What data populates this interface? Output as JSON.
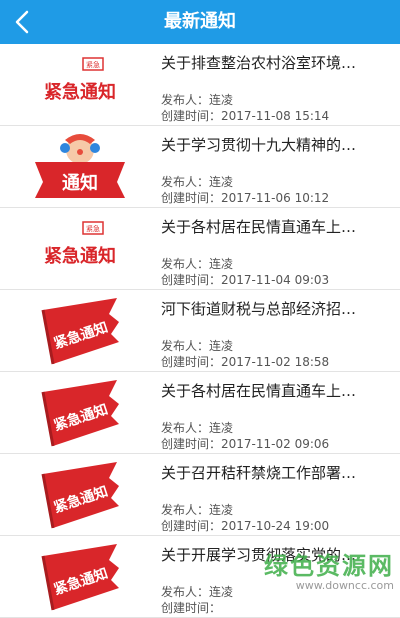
{
  "header": {
    "title": "最新通知",
    "accent_color": "#1f9be6"
  },
  "labels": {
    "publisher": "发布人：",
    "created": "创建时间："
  },
  "badges": {
    "small_top": "紧急",
    "red_stamp": "紧急通知",
    "clown_banner": "通知"
  },
  "items": [
    {
      "title": "关于排查整治农村浴室环境…",
      "publisher": "连凌",
      "time": "2017-11-08 15:14",
      "thumb": "stamp"
    },
    {
      "title": "关于学习贯彻十九大精神的…",
      "publisher": "连凌",
      "time": "2017-11-06 10:12",
      "thumb": "clown"
    },
    {
      "title": "关于各村居在民情直通车上…",
      "publisher": "连凌",
      "time": "2017-11-04 09:03",
      "thumb": "stamp"
    },
    {
      "title": "河下街道财税与总部经济招…",
      "publisher": "连凌",
      "time": "2017-11-02 18:58",
      "thumb": "flag"
    },
    {
      "title": "关于各村居在民情直通车上…",
      "publisher": "连凌",
      "time": "2017-11-02 09:06",
      "thumb": "flag"
    },
    {
      "title": "关于召开秸秆禁烧工作部署…",
      "publisher": "连凌",
      "time": "2017-10-24 19:00",
      "thumb": "flag"
    },
    {
      "title": "关于开展学习贯彻落实党的…",
      "publisher": "连凌",
      "time": "",
      "thumb": "flag"
    }
  ],
  "watermark": {
    "name": "绿色资源网",
    "url": "www.downcc.com"
  }
}
